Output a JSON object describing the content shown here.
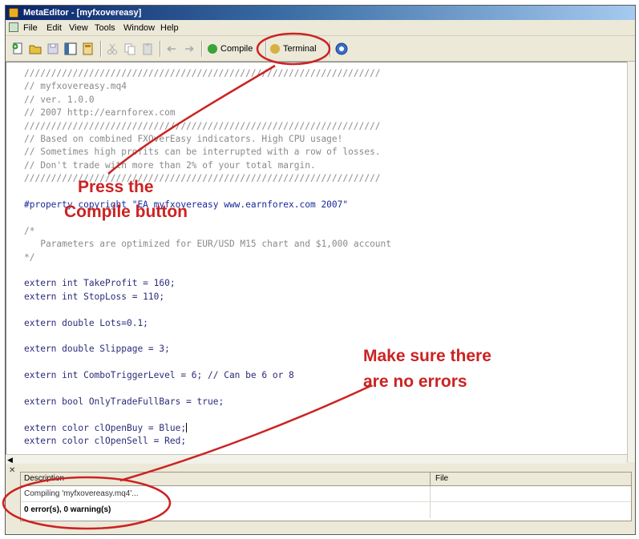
{
  "window": {
    "title": "MetaEditor - [myfxovereasy]"
  },
  "menu": [
    "File",
    "Edit",
    "View",
    "Tools",
    "Window",
    "Help"
  ],
  "toolbar": {
    "compile_label": "Compile",
    "terminal_label": "Terminal"
  },
  "code_lines": [
    {
      "text": "//////////////////////////////////////////////////////////////////",
      "kind": "comment"
    },
    {
      "text": "// myfxovereasy.mq4",
      "kind": "comment"
    },
    {
      "text": "// ver. 1.0.0",
      "kind": "comment"
    },
    {
      "text": "// 2007 http://earnforex.com",
      "kind": "comment"
    },
    {
      "text": "//////////////////////////////////////////////////////////////////",
      "kind": "comment"
    },
    {
      "text": "// Based on combined FXOverEasy indicators. High CPU usage!",
      "kind": "comment"
    },
    {
      "text": "// Sometimes high profits can be interrupted with a row of losses.",
      "kind": "comment"
    },
    {
      "text": "// Don't trade with more than 2% of your total margin.",
      "kind": "comment"
    },
    {
      "text": "//////////////////////////////////////////////////////////////////",
      "kind": "comment"
    },
    {
      "text": "",
      "kind": "blank"
    },
    {
      "text": "#property copyright \"EA myfxovereasy www.earnforex.com 2007\"",
      "kind": "prop"
    },
    {
      "text": "",
      "kind": "blank"
    },
    {
      "text": "/*",
      "kind": "comment"
    },
    {
      "text": "   Parameters are optimized for EUR/USD M15 chart and $1,000 account",
      "kind": "comment"
    },
    {
      "text": "*/",
      "kind": "comment"
    },
    {
      "text": "",
      "kind": "blank"
    },
    {
      "text": "extern int TakeProfit = 160;",
      "kind": "decl"
    },
    {
      "text": "extern int StopLoss = 110;",
      "kind": "decl"
    },
    {
      "text": "",
      "kind": "blank"
    },
    {
      "text": "extern double Lots=0.1;",
      "kind": "decl"
    },
    {
      "text": "",
      "kind": "blank"
    },
    {
      "text": "extern double Slippage = 3;",
      "kind": "decl"
    },
    {
      "text": "",
      "kind": "blank"
    },
    {
      "text": "extern int ComboTriggerLevel = 6; // Can be 6 or 8",
      "kind": "decl"
    },
    {
      "text": "",
      "kind": "blank"
    },
    {
      "text": "extern bool OnlyTradeFullBars = true;",
      "kind": "decl"
    },
    {
      "text": "",
      "kind": "blank"
    },
    {
      "text": "extern color clOpenBuy = Blue;",
      "kind": "decl",
      "cursor": true
    },
    {
      "text": "extern color clOpenSell = Red;",
      "kind": "decl"
    }
  ],
  "toolbox": {
    "col_description": "Description",
    "col_file": "File",
    "row1": "Compiling 'myfxovereasy.mq4'...",
    "row2": "0 error(s), 0 warning(s)"
  },
  "annotations": {
    "compile_line1": "Press the",
    "compile_line2": "Compile button",
    "errors_line1": "Make sure there",
    "errors_line2": "are no errors"
  },
  "colors": {
    "annotation": "#cc2222",
    "comment": "#8a8a8a",
    "code": "#2b2b7a"
  }
}
